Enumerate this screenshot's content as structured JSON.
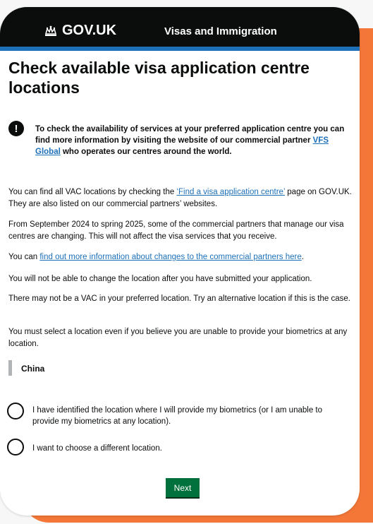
{
  "header": {
    "logo_text": "GOV.UK",
    "service_name": "Visas and Immigration",
    "colors": {
      "header_bg": "#0b0c0c",
      "header_stripe": "#1d70b8"
    }
  },
  "main": {
    "title": "Check available visa application centre locations",
    "warning": {
      "icon": "exclamation-icon",
      "text_before_link": "To check the availability of services at your preferred application centre you can find more information by visiting the website of our commercial partner ",
      "link_text": "VFS Global",
      "text_after_link": " who operates our centres around the world."
    },
    "p1": {
      "before": "You can find all VAC locations by checking the ",
      "link": "‘Find a visa application centre’",
      "after": " page on GOV.UK. They are also listed on our commercial partners’ websites."
    },
    "p2": "From September 2024 to spring 2025, some of the commercial partners that manage our visa centres are changing. This will not affect the visa services that you receive.",
    "p3": {
      "before": "You can ",
      "link": "find out more information about changes to the commercial partners here",
      "after": "."
    },
    "p4": "You will not be able to change the location after you have submitted your application.",
    "p5": "There may not be a VAC in your preferred location. Try an alternative location if this is the case.",
    "p6": "You must select a location even if you believe you are unable to provide your biometrics at any location.",
    "selected_location": "China",
    "options": [
      {
        "label": "I have identified the location where I will provide my biometrics (or I am unable to provide my biometrics at any location)."
      },
      {
        "label": "I want to choose a different location."
      }
    ],
    "next_label": "Next",
    "colors": {
      "link": "#1d70b8",
      "button": "#00703c",
      "accent": "#f47738"
    }
  }
}
